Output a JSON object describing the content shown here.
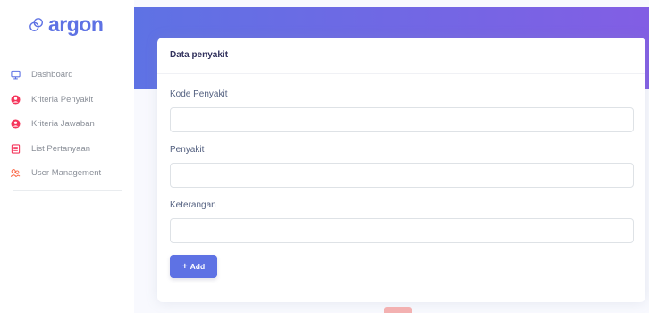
{
  "brand": {
    "name": "argon",
    "color": "#5e72e4"
  },
  "sidebar": {
    "items": [
      {
        "label": "Dashboard",
        "icon": "monitor-icon",
        "color": "#5e72e4"
      },
      {
        "label": "Kriteria Penyakit",
        "icon": "user-circle-icon",
        "color": "#f5365c"
      },
      {
        "label": "Kriteria Jawaban",
        "icon": "user-circle-icon",
        "color": "#f5365c"
      },
      {
        "label": "List Pertanyaan",
        "icon": "list-icon",
        "color": "#f5365c"
      },
      {
        "label": "User Management",
        "icon": "users-icon",
        "color": "#fb6340"
      }
    ]
  },
  "header": {
    "gradient_start": "#5e72e4",
    "gradient_end": "#825ee4"
  },
  "card": {
    "title": "Data penyakit",
    "fields": [
      {
        "label": "Kode Penyakit",
        "value": "",
        "placeholder": ""
      },
      {
        "label": "Penyakit",
        "value": "",
        "placeholder": ""
      },
      {
        "label": "Keterangan",
        "value": "",
        "placeholder": ""
      }
    ],
    "add_button": {
      "icon": "plus-icon",
      "label": "Add"
    }
  }
}
